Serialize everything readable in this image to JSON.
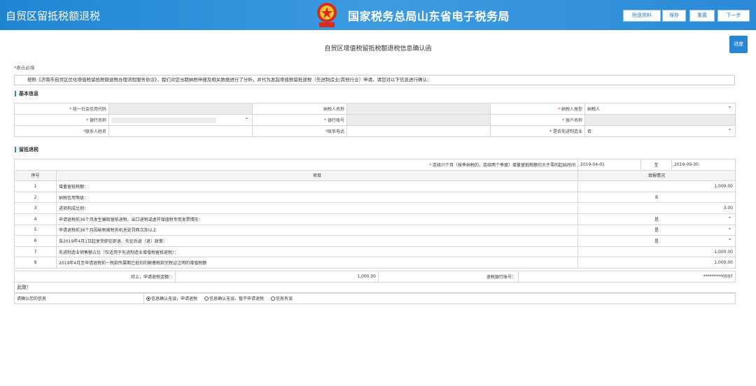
{
  "header": {
    "app_title": "自贸区留抵税额退税",
    "org_title": "国家税务总局山东省电子税务局",
    "buttons": [
      "附送资料",
      "保存",
      "重置",
      "下一步"
    ],
    "color": "#2a86d1"
  },
  "side_button": "进度",
  "page_title": "自贸区增值税留抵税额退税信息确认函",
  "required_note": "表示必填",
  "notice": "按照《济南市自贸区优化增值税留抵税额退税办理流程服务协议》，我们对您当期纳税申报及相关数据进行了分析，并代为发起增值税留抵退税（先进制造业/其他行业）申请。请您对以下信息进行确认：",
  "basic": {
    "title": "基本信息",
    "labels": {
      "credit_code": "统一社会信用代码",
      "taxpayer_name": "纳税人名称",
      "taxpayer_type": "纳税人类型",
      "bank_name": "银行名称",
      "bank_account": "银行账号",
      "account_name": "账户名称",
      "contact_name": "联系人姓名",
      "contact_phone": "联系电话",
      "advanced_mfg": "是否先进制造业"
    },
    "values": {
      "taxpayer_type": "纳税人",
      "bank_name": "",
      "advanced_mfg": "否"
    }
  },
  "refund": {
    "title": "留抵退税",
    "period_label": "连续六个月（按季纳税的，连续两个季度）增量留抵税额均大于零的起始时间",
    "period_start": "2019-04-01",
    "period_to": "至",
    "period_end": "2019-09-30",
    "col_no": "序号",
    "col_item": "项目",
    "col_fill": "填报情况",
    "rows": [
      {
        "no": "1",
        "item": "增量留抵税额：",
        "value": "1,000.00",
        "kind": "num"
      },
      {
        "no": "2",
        "item": "纳税信用等级：",
        "value": "B",
        "kind": "center"
      },
      {
        "no": "3",
        "item": "进项构成比例：",
        "value": "3.00",
        "kind": "num"
      },
      {
        "no": "4",
        "item": "申请退税前36个月发生骗取留抵退税、出口退税或虚开增值税专用发票情形：",
        "value": "是",
        "kind": "select"
      },
      {
        "no": "5",
        "item": "申请退税前36个月因偷税被税务机关处罚两次及以上",
        "value": "是",
        "kind": "select"
      },
      {
        "no": "6",
        "item": "自2019年4月1日起享受即征即退、先征后返（退）政策：",
        "value": "是",
        "kind": "select"
      },
      {
        "no": "7",
        "item": "先进制造业销售额占比（仅适用于先进制造业增值税留抵退税）：",
        "value": "1,000.00",
        "kind": "num"
      },
      {
        "no": "8",
        "item": "2019年4月至申请退税前一税款所属期已抵扣的解缴税款完税证注明的增值税额",
        "value": "1,000.00",
        "kind": "num"
      }
    ],
    "summary_label": "综上，申请退税金额：",
    "summary_amount": "1,000.00",
    "refund_account_label": "退税银行账号：",
    "refund_account": "*********0007",
    "closing": "此致！",
    "confirm_label": "请确认您的信息",
    "options": [
      "信息确认无误，申请退税",
      "信息确认无误，暂不申请退税",
      "信息有误"
    ],
    "selected_option": 0
  }
}
